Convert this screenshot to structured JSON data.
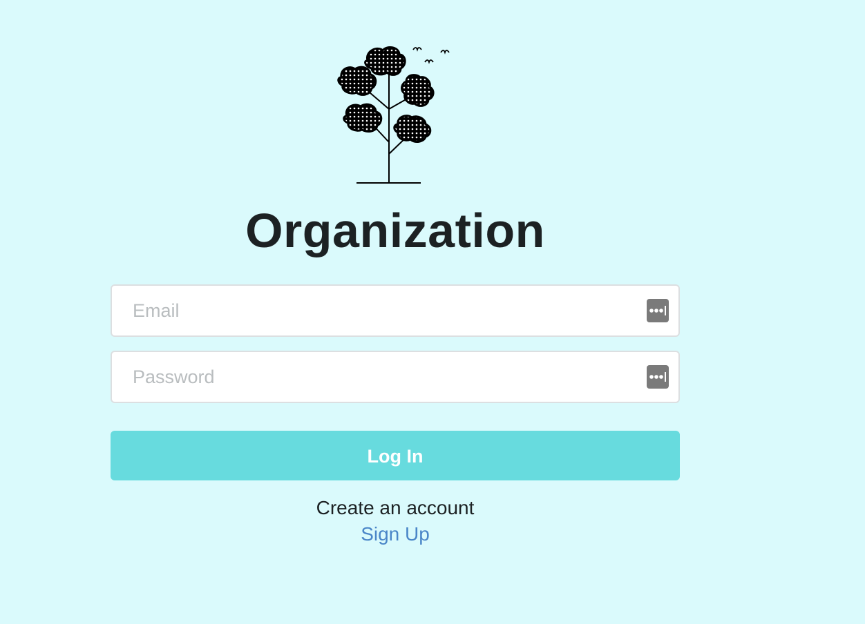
{
  "brand": {
    "logo_icon": "tree-with-birds-icon",
    "title": "Organization"
  },
  "form": {
    "email": {
      "placeholder": "Email",
      "value": "",
      "password_manager_icon": "password-manager-icon"
    },
    "password": {
      "placeholder": "Password",
      "value": "",
      "password_manager_icon": "password-manager-icon"
    },
    "login_button_label": "Log In"
  },
  "footer": {
    "create_account_text": "Create an account",
    "signup_link_label": "Sign Up"
  },
  "colors": {
    "background": "#dafafc",
    "button": "#67dbde",
    "link": "#4a86c8",
    "title": "#1c2123"
  }
}
